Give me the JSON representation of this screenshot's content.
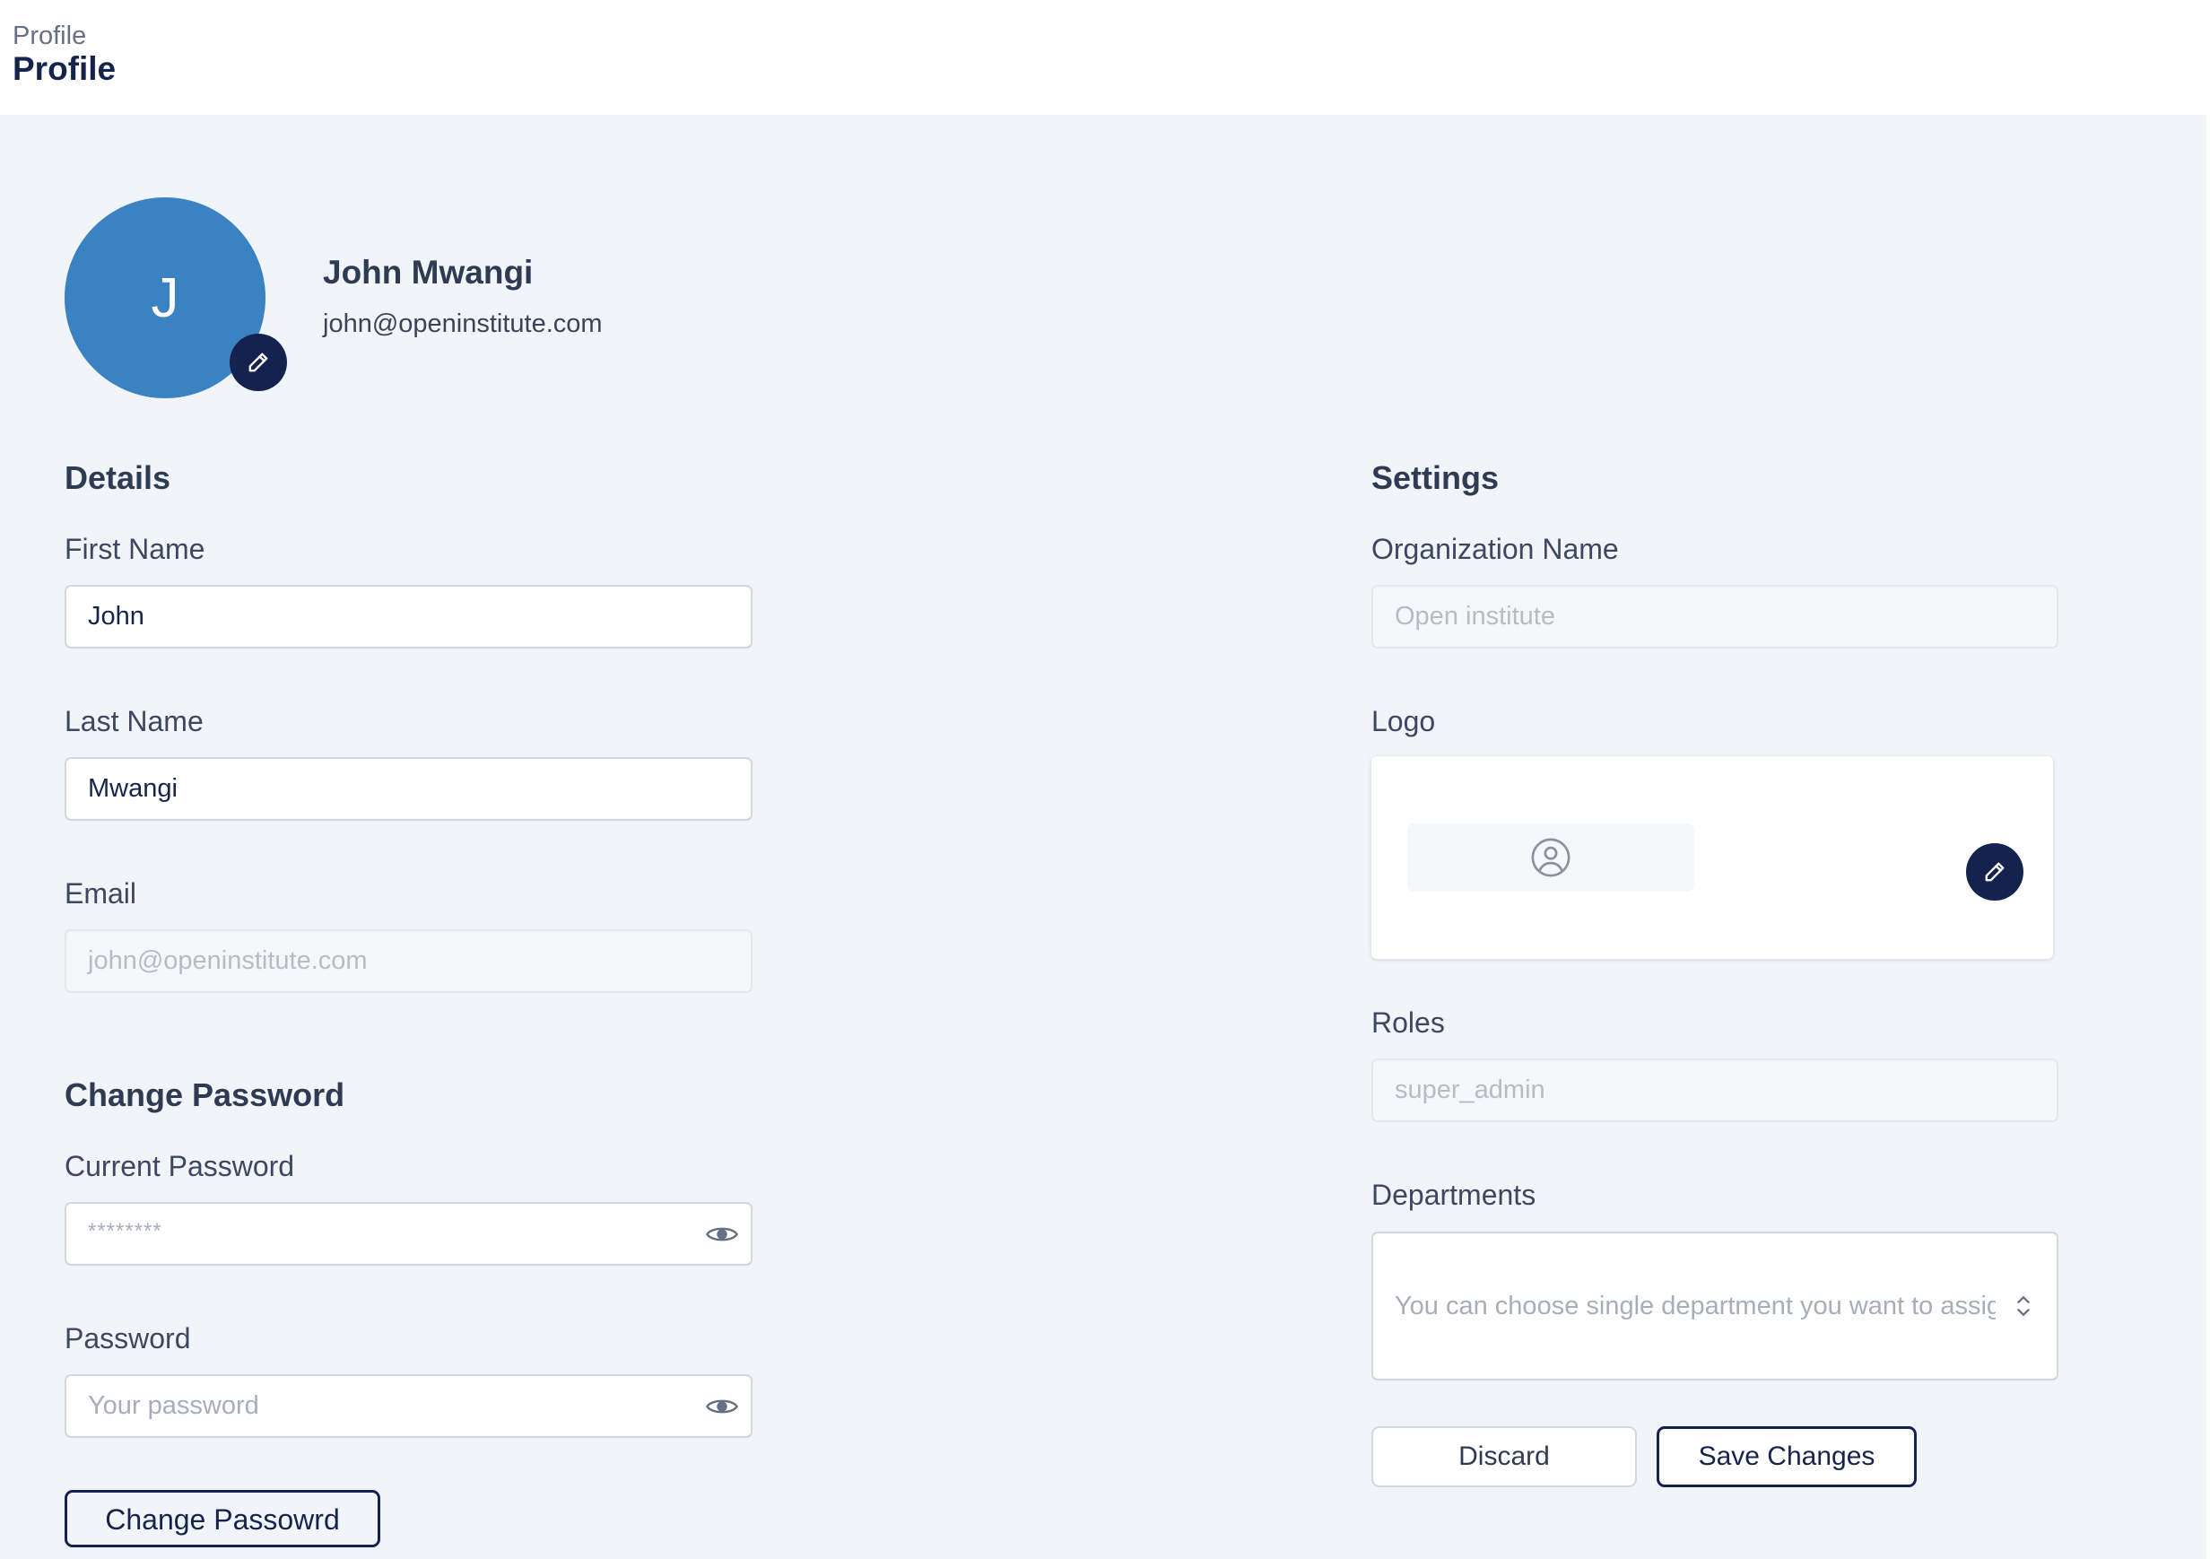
{
  "header": {
    "breadcrumb": "Profile",
    "title": "Profile"
  },
  "profile": {
    "avatar_initial": "J",
    "name": "John Mwangi",
    "email": "john@openinstitute.com",
    "avatar_color": "#3a82c2",
    "badge_color": "#14224e"
  },
  "details": {
    "title": "Details",
    "first_name": {
      "label": "First Name",
      "value": "John"
    },
    "last_name": {
      "label": "Last Name",
      "value": "Mwangi"
    },
    "email": {
      "label": "Email",
      "value": "john@openinstitute.com",
      "disabled": true
    }
  },
  "change_password": {
    "title": "Change Password",
    "current_password": {
      "label": "Current Password",
      "placeholder": "********"
    },
    "password": {
      "label": "Password",
      "placeholder": "Your password"
    },
    "button_label": "Change Passowrd"
  },
  "settings": {
    "title": "Settings",
    "organization_name": {
      "label": "Organization Name",
      "value": "Open institute",
      "disabled": true
    },
    "logo": {
      "label": "Logo"
    },
    "roles": {
      "label": "Roles",
      "value": "super_admin",
      "disabled": true
    },
    "departments": {
      "label": "Departments",
      "placeholder": "You can choose single department you want to assign"
    }
  },
  "actions": {
    "discard_label": "Discard",
    "save_label": "Save Changes"
  }
}
